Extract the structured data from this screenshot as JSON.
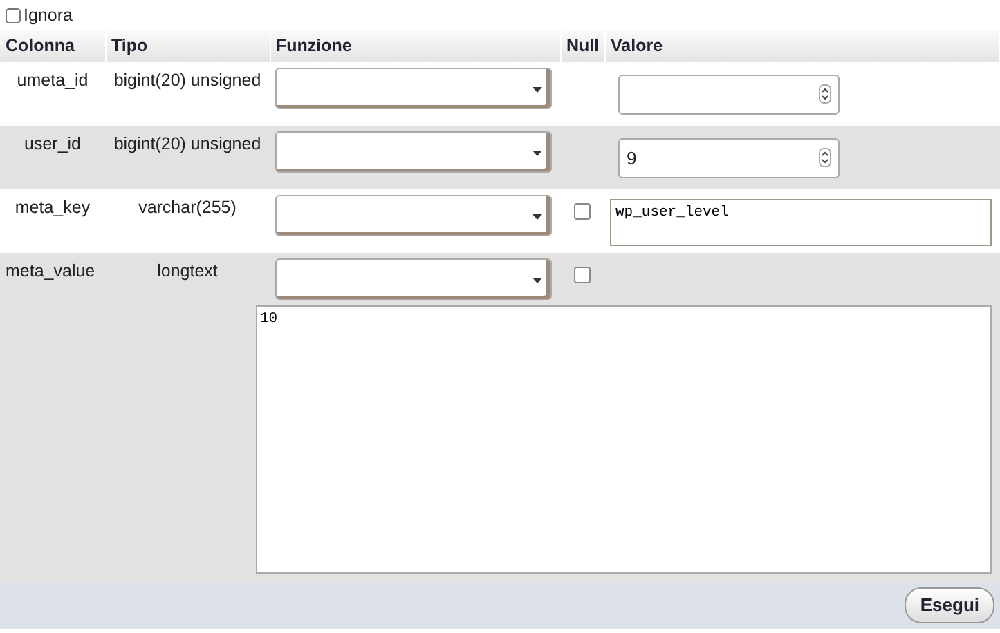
{
  "ignore": {
    "label": "Ignora",
    "checked": false
  },
  "columns": [
    "Colonna",
    "Tipo",
    "Funzione",
    "Null",
    "Valore"
  ],
  "rows": [
    {
      "column": "umeta_id",
      "type": "bigint(20) unsigned",
      "kind": "number"
    },
    {
      "column": "user_id",
      "type": "bigint(20) unsigned",
      "kind": "number",
      "value": "9"
    },
    {
      "column": "meta_key",
      "type": "varchar(255)",
      "null_checked": false,
      "kind": "text",
      "value": "wp_user_level"
    },
    {
      "column": "meta_value",
      "type": "longtext",
      "null_checked": false,
      "kind": "longtext",
      "value": "10"
    }
  ],
  "submit": "Esegui"
}
